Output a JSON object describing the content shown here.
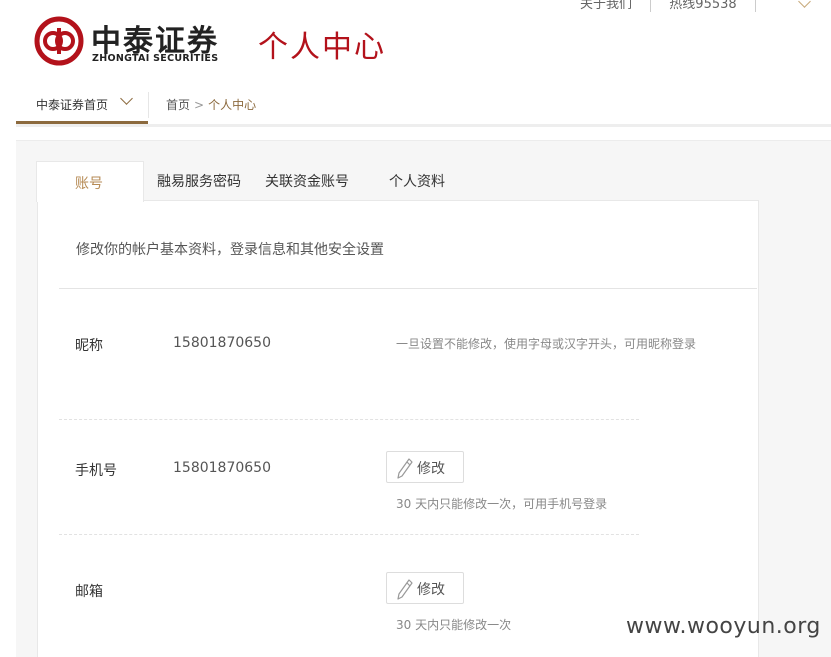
{
  "top_links": {
    "about": "关于我们",
    "hotline": "热线95538"
  },
  "logo": {
    "cn": "中泰证券",
    "en": "ZHONGTAI SECURITIES"
  },
  "page_heading": "个人中心",
  "nav": {
    "home": "中泰证券首页",
    "breadcrumb": {
      "home": "首页",
      "separator": ">",
      "current": "个人中心"
    }
  },
  "tabs": [
    "账号",
    "融易服务密码",
    "关联资金账号",
    "个人资料"
  ],
  "intro": "修改你的帐户基本资料，登录信息和其他安全设置",
  "fields": {
    "nickname": {
      "label": "昵称",
      "value": "15801870650",
      "hint": "一旦设置不能修改，使用字母或汉字开头，可用昵称登录"
    },
    "phone": {
      "label": "手机号",
      "value": "15801870650",
      "button": "修改",
      "hint": "30 天内只能修改一次，可用手机号登录"
    },
    "email": {
      "label": "邮箱",
      "button": "修改",
      "hint": "30 天内只能修改一次"
    }
  },
  "watermark": "www.wooyun.org",
  "colors": {
    "brand_red": "#b3121b",
    "accent_gold": "#8c6a3e",
    "tab_active": "#b68a54"
  }
}
